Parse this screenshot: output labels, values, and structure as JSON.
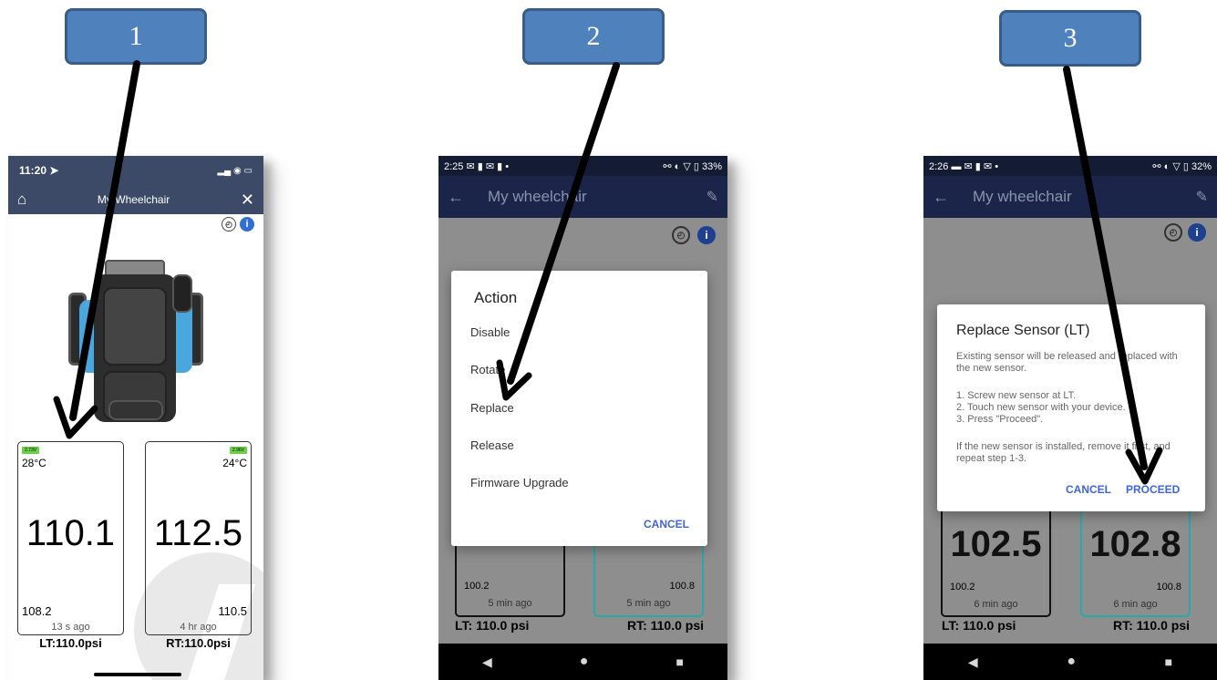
{
  "callouts": [
    "1",
    "2",
    "3"
  ],
  "p1": {
    "time": "11:20",
    "title": "My Wheelchair",
    "left": {
      "voltage": "2.73V",
      "temp": "28°C",
      "value": "110.1",
      "min": "108.2",
      "ago": "13 s ago",
      "caption": "LT:110.0psi"
    },
    "right": {
      "voltage": "2.96V",
      "temp": "24°C",
      "value": "112.5",
      "min": "110.5",
      "ago": "4 hr ago",
      "caption": "RT:110.0psi"
    }
  },
  "p2": {
    "time": "2:25",
    "battery": "33%",
    "title": "My wheelchair",
    "dialog_title": "Action",
    "actions": [
      "Disable",
      "Rotate",
      "Replace",
      "Release",
      "Firmware Upgrade"
    ],
    "cancel": "CANCEL",
    "left": {
      "min": "100.2",
      "ago": "5 min ago",
      "caption": "LT: 110.0 psi"
    },
    "right": {
      "min": "100.8",
      "ago": "5 min ago",
      "caption": "RT: 110.0 psi"
    }
  },
  "p3": {
    "time": "2:26",
    "battery": "32%",
    "title": "My wheelchair",
    "dialog_title": "Replace Sensor (LT)",
    "intro": "Existing sensor will be released and replaced with the new sensor.",
    "steps": [
      "1. Screw new sensor at LT.",
      "2. Touch new sensor with your device.",
      "3. Press \"Proceed\"."
    ],
    "note": "If the new sensor is installed, remove it first, and repeat step 1-3.",
    "cancel": "CANCEL",
    "proceed": "PROCEED",
    "left": {
      "value": "102.5",
      "min": "100.2",
      "ago": "6 min ago",
      "caption": "LT: 110.0 psi"
    },
    "right": {
      "value": "102.8",
      "min": "100.8",
      "ago": "6 min ago",
      "caption": "RT: 110.0 psi"
    }
  },
  "colors": {
    "callout": "#4f81bd",
    "ios_header": "#3c4a68",
    "android_header": "#22315e",
    "accent": "#3f63d8",
    "teal": "#2aa9a9"
  },
  "icons": [
    "home-icon",
    "wrench-icon",
    "back-arrow-icon",
    "gauge-icon",
    "info-icon"
  ]
}
